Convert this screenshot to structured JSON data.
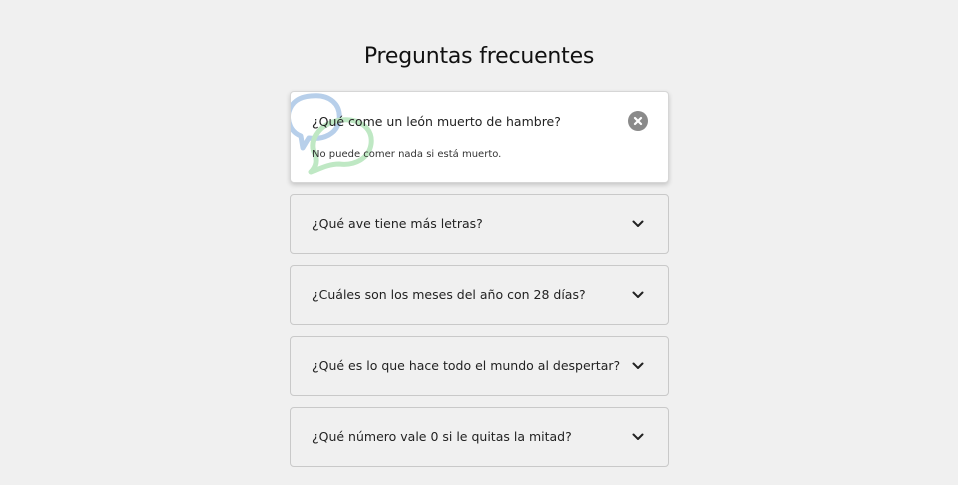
{
  "page": {
    "title": "Preguntas frecuentes"
  },
  "faqs": [
    {
      "question": "¿Qué come un león muerto de hambre?",
      "answer": "No puede comer nada si está muerto.",
      "expanded": true
    },
    {
      "question": "¿Qué ave tiene más letras?",
      "expanded": false
    },
    {
      "question": "¿Cuáles son los meses del año con 28 días?",
      "expanded": false
    },
    {
      "question": "¿Qué es lo que hace todo el mundo al despertar?",
      "expanded": false
    },
    {
      "question": "¿Qué número vale 0 si le quitas la mitad?",
      "expanded": false
    }
  ],
  "icons": {
    "close": "close-circle-icon",
    "expand": "chevron-down-icon",
    "decoration": "speech-bubbles-icon"
  },
  "colors": {
    "background": "#f0f0f0",
    "card_active": "#ffffff",
    "close_button": "#8a8a8a",
    "bubble_blue": "#b7cfea",
    "bubble_green": "#bfe8c4"
  }
}
